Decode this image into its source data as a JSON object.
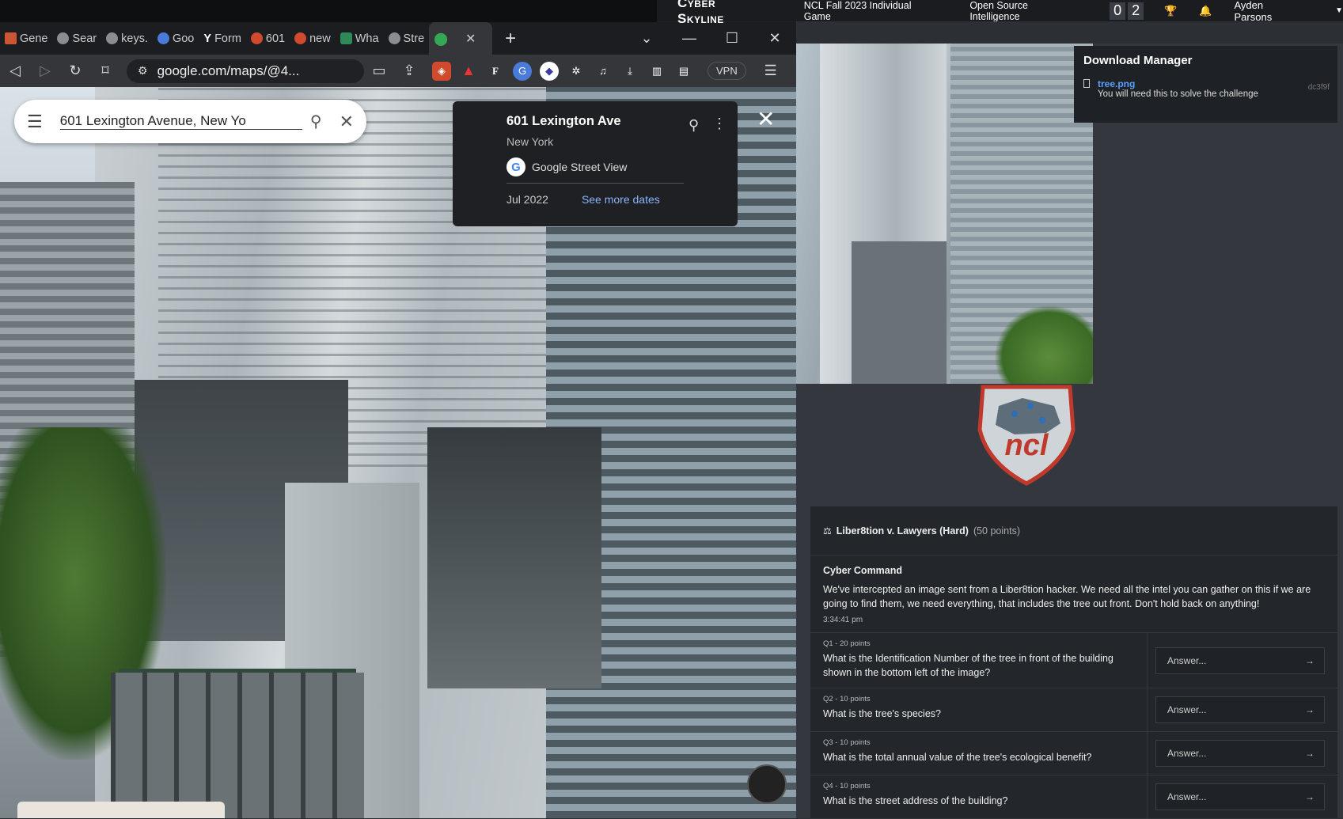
{
  "ncl_nav": {
    "brand": "Cyber Skyline",
    "game": "NCL Fall 2023 Individual Game",
    "category": "Open Source Intelligence",
    "score_digits": [
      "0",
      "2"
    ],
    "user": "Ayden Parsons"
  },
  "download_manager": {
    "title": "Download Manager",
    "file_name": "tree.png",
    "file_desc": "You will need this to solve the challenge",
    "hash": "dc3f9f"
  },
  "challenge": {
    "title": "Liber8tion v. Lawyers (Hard)",
    "points": "(50 points)",
    "from": "Cyber Command",
    "body": "We've intercepted an image sent from a Liber8tion hacker. We need all the intel you can gather on this if we are going to find them, we need everything, that includes the tree out front. Don't hold back on anything!",
    "time": "3:34:41 pm",
    "questions": [
      {
        "label": "Q1 - 20 points",
        "text": "What is the Identification Number of the tree in front of the building shown in the bottom left of the image?",
        "placeholder": "Answer..."
      },
      {
        "label": "Q2 - 10 points",
        "text": "What is the tree's species?",
        "placeholder": "Answer..."
      },
      {
        "label": "Q3 - 10 points",
        "text": "What is the total annual value of the tree's ecological benefit?",
        "placeholder": "Answer..."
      },
      {
        "label": "Q4 - 10 points",
        "text": "What is the street address of the building?",
        "placeholder": "Answer..."
      }
    ]
  },
  "browser": {
    "tabs": [
      "Gene",
      "Sear",
      "keys.",
      "Goo",
      "Form",
      "601",
      "new",
      "Wha",
      "Stre"
    ],
    "url": "google.com/maps/@4...",
    "vpn": "VPN"
  },
  "maps": {
    "search_query": "601 Lexington Avenue, New Yo",
    "card_title": "601 Lexington Ave",
    "card_sub": "New York",
    "card_source": "Google Street View",
    "card_date": "Jul 2022",
    "card_more": "See more dates"
  }
}
